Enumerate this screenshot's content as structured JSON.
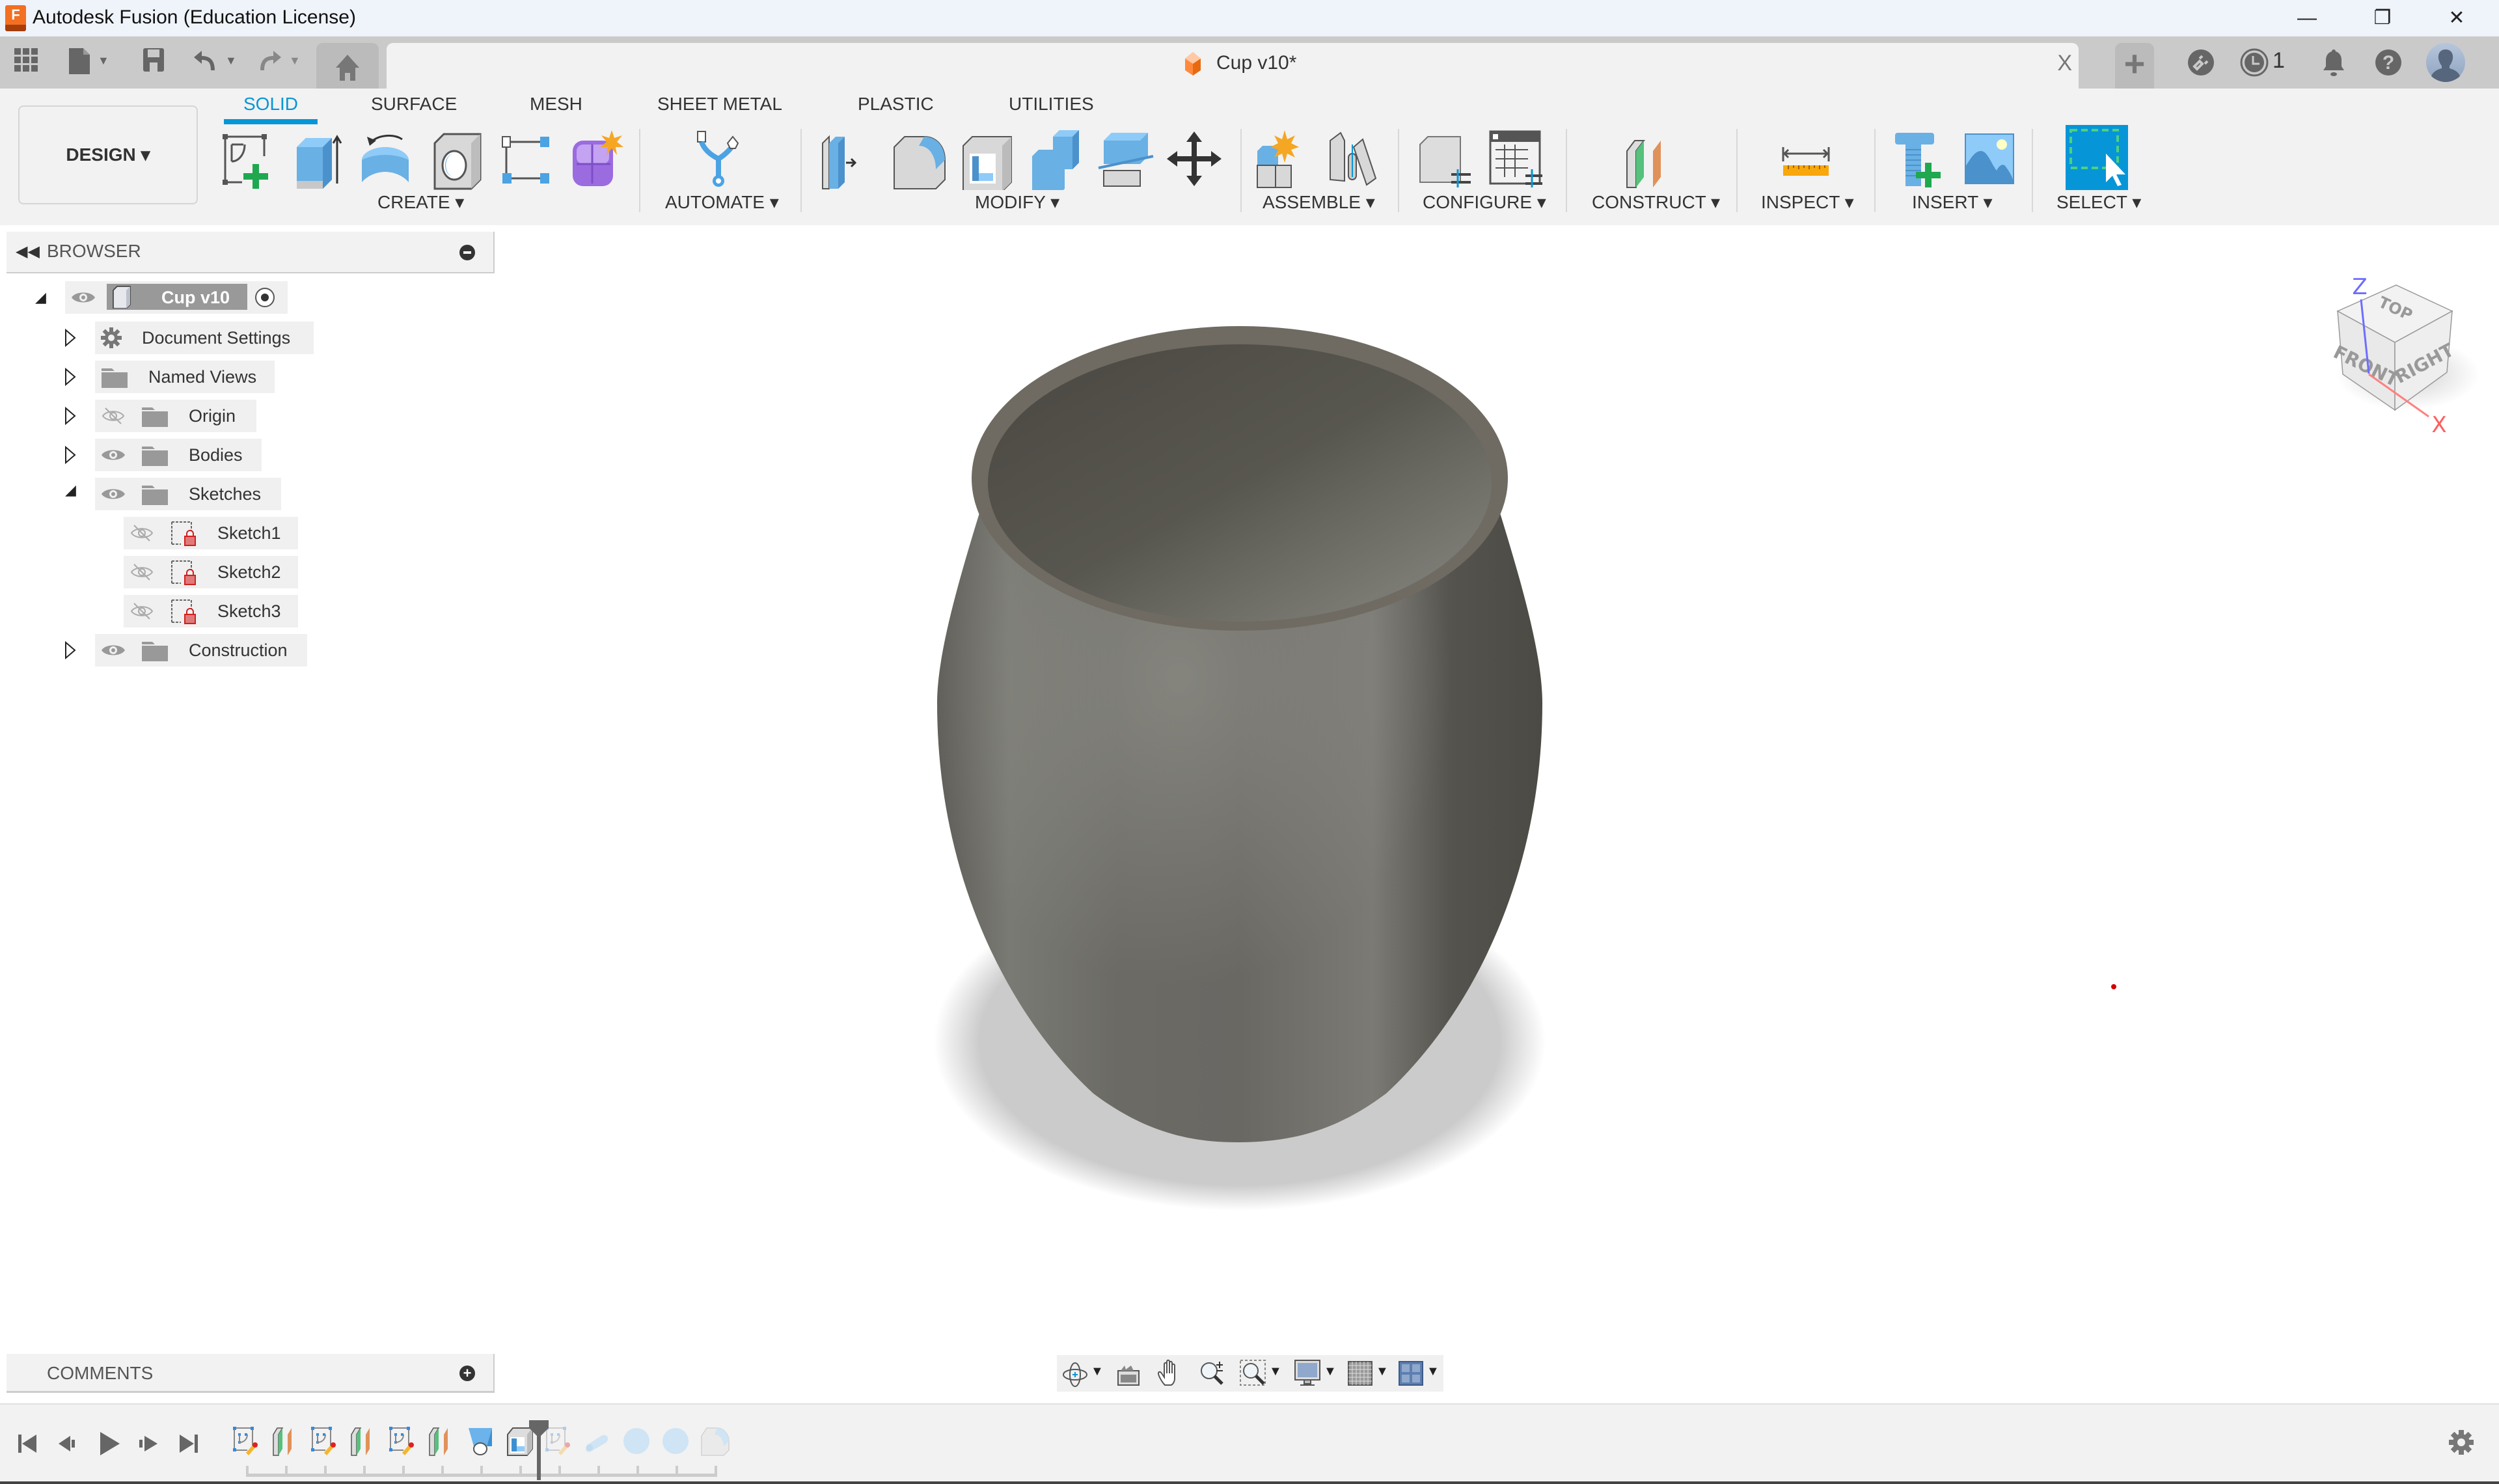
{
  "window": {
    "title": "Autodesk Fusion (Education License)",
    "logo_text": "F",
    "controls": {
      "minimize": "—",
      "restore": "❐",
      "close": "✕"
    }
  },
  "quick_access": {
    "icons": [
      "app-grid-icon",
      "file-icon",
      "save-icon",
      "undo-icon",
      "redo-icon",
      "home-icon"
    ],
    "document_tab": {
      "title": "Cup v10*",
      "close": "X"
    },
    "new_tab": "+",
    "right": {
      "extensions_icon": "plug-icon",
      "job_status_icon": "clock-icon",
      "job_count": "1",
      "notifications_icon": "bell-icon",
      "help_icon": "help-icon",
      "profile_icon": "avatar"
    }
  },
  "ribbon": {
    "workspace": "DESIGN ▾",
    "tabs": [
      "SOLID",
      "SURFACE",
      "MESH",
      "SHEET METAL",
      "PLASTIC",
      "UTILITIES"
    ],
    "active_tab": "SOLID",
    "groups": [
      {
        "label": "CREATE ▾",
        "tools": [
          "create-sketch",
          "extrude",
          "revolve",
          "hole",
          "rectangular-pattern",
          "create-form"
        ]
      },
      {
        "label": "AUTOMATE ▾",
        "tools": [
          "automated-modeling"
        ]
      },
      {
        "label": "MODIFY ▾",
        "tools": [
          "press-pull",
          "fillet",
          "shell",
          "combine",
          "offset-face",
          "move-copy"
        ]
      },
      {
        "label": "ASSEMBLE ▾",
        "tools": [
          "new-component",
          "joint"
        ]
      },
      {
        "label": "CONFIGURE ▾",
        "tools": [
          "change-parameters",
          "configuration-table"
        ]
      },
      {
        "label": "CONSTRUCT ▾",
        "tools": [
          "offset-plane"
        ]
      },
      {
        "label": "INSPECT ▾",
        "tools": [
          "measure"
        ]
      },
      {
        "label": "INSERT ▾",
        "tools": [
          "insert-mcmaster",
          "insert-canvas"
        ]
      },
      {
        "label": "SELECT ▾",
        "tools": [
          "window-select"
        ]
      }
    ],
    "accent_color": "#0696d7"
  },
  "browser": {
    "title": "BROWSER",
    "root": {
      "label": "Cup v10"
    },
    "items": [
      {
        "label": "Document Settings",
        "icon": "gear-icon",
        "visible": null
      },
      {
        "label": "Named Views",
        "icon": "folder-icon",
        "visible": null
      },
      {
        "label": "Origin",
        "icon": "folder-icon",
        "visible": false
      },
      {
        "label": "Bodies",
        "icon": "folder-icon",
        "visible": true
      },
      {
        "label": "Sketches",
        "icon": "folder-icon",
        "visible": true,
        "expanded": true,
        "children": [
          {
            "label": "Sketch1",
            "visible": false
          },
          {
            "label": "Sketch2",
            "visible": false
          },
          {
            "label": "Sketch3",
            "visible": false
          }
        ]
      },
      {
        "label": "Construction",
        "icon": "folder-icon",
        "visible": true
      }
    ]
  },
  "viewcube": {
    "top": "TOP",
    "front": "FRONT",
    "right": "RIGHT",
    "axis_z": "Z",
    "axis_x": "X"
  },
  "comments": {
    "title": "COMMENTS"
  },
  "viewport_toolbar": [
    "orbit-icon",
    "look-at-icon",
    "pan-icon",
    "zoom-icon",
    "fit-icon",
    "display-settings-icon",
    "grid-icon",
    "viewports-icon"
  ],
  "timeline": {
    "controls": [
      "first",
      "previous",
      "play",
      "next",
      "last"
    ],
    "features": [
      {
        "type": "sketch",
        "active": true
      },
      {
        "type": "plane",
        "active": true
      },
      {
        "type": "sketch",
        "active": true
      },
      {
        "type": "plane",
        "active": true
      },
      {
        "type": "sketch",
        "active": true
      },
      {
        "type": "plane",
        "active": true
      },
      {
        "type": "loft",
        "active": true
      },
      {
        "type": "shell",
        "active": true
      },
      {
        "type": "sketch",
        "active": false
      },
      {
        "type": "pipe",
        "active": false
      },
      {
        "type": "sphere",
        "active": false
      },
      {
        "type": "sphere",
        "active": false
      },
      {
        "type": "fillet",
        "active": false
      }
    ],
    "marker_position_after_index": 7
  }
}
